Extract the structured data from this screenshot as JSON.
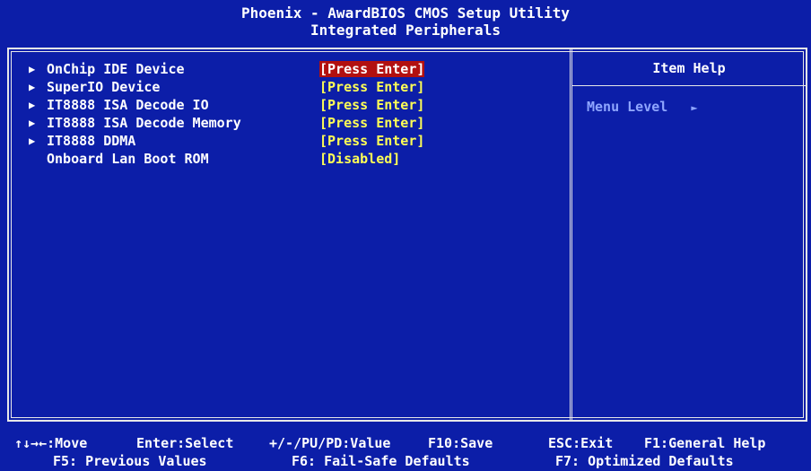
{
  "header": {
    "line1": "Phoenix - AwardBIOS CMOS Setup Utility",
    "line2": "Integrated Peripherals"
  },
  "menu": {
    "items": [
      {
        "label": "OnChip IDE Device",
        "value": "[Press Enter]",
        "submenu": true,
        "selected": true
      },
      {
        "label": "SuperIO Device",
        "value": "[Press Enter]",
        "submenu": true,
        "selected": false
      },
      {
        "label": "IT8888 ISA Decode IO",
        "value": "[Press Enter]",
        "submenu": true,
        "selected": false
      },
      {
        "label": "IT8888 ISA Decode Memory",
        "value": "[Press Enter]",
        "submenu": true,
        "selected": false
      },
      {
        "label": "IT8888 DDMA",
        "value": "[Press Enter]",
        "submenu": true,
        "selected": false
      },
      {
        "label": "Onboard Lan Boot ROM",
        "value": "[Disabled]",
        "submenu": false,
        "selected": false
      }
    ]
  },
  "help": {
    "title": "Item Help",
    "menu_level_label": "Menu Level",
    "menu_level_arrow": "►"
  },
  "footer": {
    "move": "↑↓→←:Move",
    "select": "Enter:Select",
    "value": "+/-/PU/PD:Value",
    "save": "F10:Save",
    "exit": "ESC:Exit",
    "help": "F1:General Help",
    "prev": "F5: Previous Values",
    "failsafe": "F6: Fail-Safe Defaults",
    "optimized": "F7: Optimized Defaults"
  },
  "colors": {
    "background": "#0c1ea8",
    "text": "#ffffff",
    "value": "#ffff55",
    "highlight": "#b21010",
    "help_text": "#8fa6ff"
  },
  "icons": {
    "submenu_arrow": "triangle-right-icon"
  }
}
